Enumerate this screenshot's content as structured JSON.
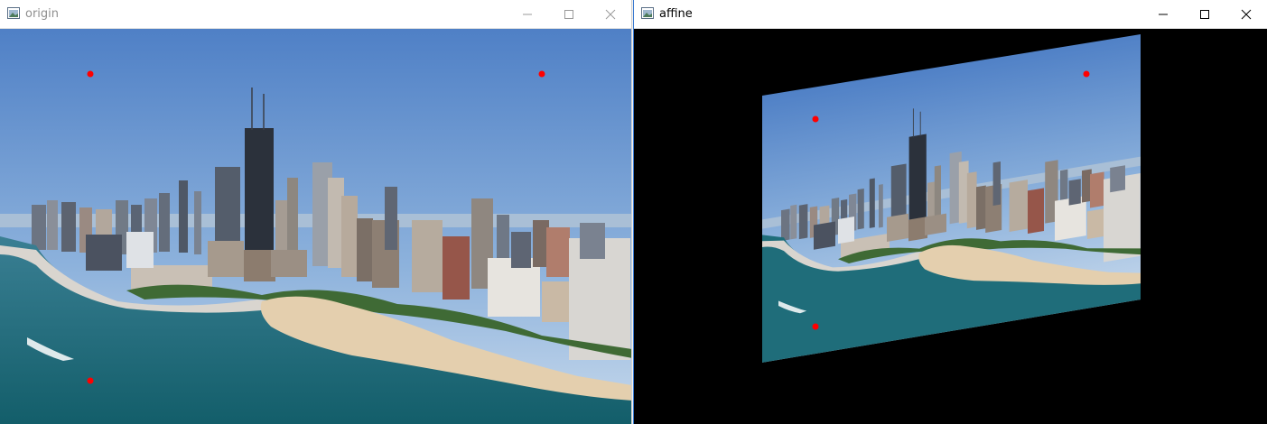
{
  "windows": {
    "origin": {
      "title": "origin",
      "controls": {
        "minimize_icon": "minimize-icon",
        "maximize_icon": "maximize-icon",
        "close_icon": "close-icon"
      },
      "image_description_icon": "image-icon",
      "marker_color": "#ff0000"
    },
    "affine": {
      "title": "affine",
      "controls": {
        "minimize_icon": "minimize-icon",
        "maximize_icon": "maximize-icon",
        "close_icon": "close-icon"
      },
      "background_color": "#000000",
      "marker_color": "#ff0000"
    }
  },
  "colors": {
    "sky": "#5f8fcf",
    "water": "#1f6d7a",
    "sand": "#e6d2b4",
    "titlebar": "#ffffff",
    "accent_border": "#3b7bd1"
  }
}
